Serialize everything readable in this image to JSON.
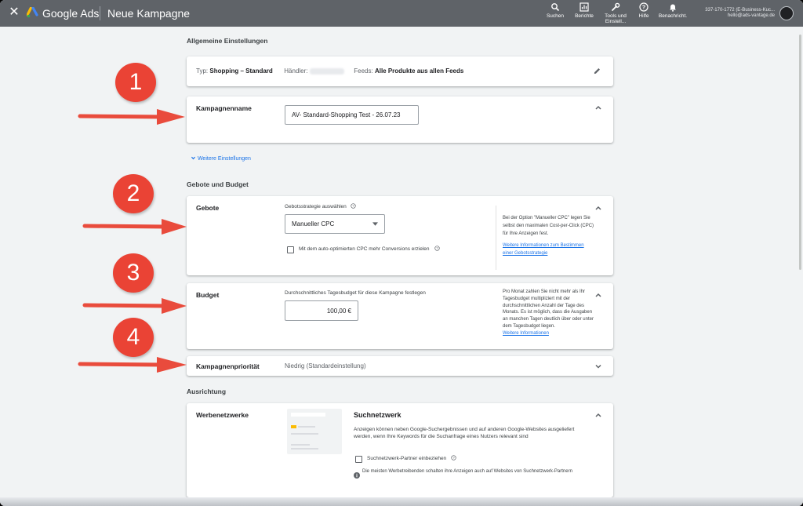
{
  "topbar": {
    "brand": "Google Ads",
    "page_title": "Neue Kampagne",
    "tools": [
      {
        "label": "Suchen",
        "icon": "search-icon"
      },
      {
        "label": "Berichte",
        "icon": "reports-icon"
      },
      {
        "label": "Tools und Einstell...",
        "icon": "wrench-icon"
      },
      {
        "label": "Hilfe",
        "icon": "help-icon"
      },
      {
        "label": "Benachricht.",
        "icon": "bell-icon"
      }
    ],
    "account_id": "337-170-1772 (E-Business-Kuc...",
    "account_email": "hello@ads-vantage.de"
  },
  "general": {
    "heading": "Allgemeine Einstellungen",
    "summary": {
      "type_label": "Typ:",
      "type_value": "Shopping – Standard",
      "merchant_label": "Händler:",
      "feeds_label": "Feeds:",
      "feeds_value": "Alle Produkte aus allen Feeds"
    },
    "campaign_name": {
      "title": "Kampagnenname",
      "value": "AV- Standard-Shopping Test - 26.07.23"
    },
    "more_settings": "Weitere Einstellungen"
  },
  "bids_budget": {
    "heading": "Gebote und Budget",
    "bids": {
      "title": "Gebote",
      "strategy_label": "Gebotsstrategie auswählen",
      "strategy_value": "Manueller CPC",
      "checkbox_label": "Mit dem auto-optimierten CPC mehr Conversions erzielen",
      "help_text": "Bei der Option \"Manueller CPC\" legen Sie selbst den maximalen Cost-per-Click (CPC) für Ihre Anzeigen fest.",
      "help_link": "Weitere Informationen zum Bestimmen einer Gebotsstrategie"
    },
    "budget": {
      "title": "Budget",
      "label": "Durchschnittliches Tagesbudget für diese Kampagne festlegen",
      "value": "100,00 €",
      "help_text": "Pro Monat zahlen Sie nicht mehr als Ihr Tagesbudget multipliziert mit der durchschnittlichen Anzahl der Tage des Monats. Es ist möglich, dass die Ausgaben an manchen Tagen deutlich über oder unter dem Tagesbudget liegen.",
      "help_link": "Weitere Informationen"
    },
    "priority": {
      "title": "Kampagnenpriorität",
      "value": "Niedrig (Standardeinstellung)"
    }
  },
  "targeting": {
    "heading": "Ausrichtung",
    "networks": {
      "title": "Werbenetzwerke",
      "network_title": "Suchnetzwerk",
      "description": "Anzeigen können neben Google-Suchergebnissen und auf anderen Google-Websites ausgeliefert werden, wenn Ihre Keywords für die Suchanfrage eines Nutzers relevant sind",
      "partner_label": "Suchnetzwerk-Partner einbeziehen",
      "info_text": "Die meisten Werbetreibenden schalten ihre Anzeigen auch auf Websites von Suchnetzwerk-Partnern"
    }
  },
  "markers": [
    "1",
    "2",
    "3",
    "4"
  ],
  "colors": {
    "topbar": "#5f6368",
    "page_bg": "#f1f3f4",
    "marker": "#ea4335",
    "link": "#1a73e8",
    "google_blue": "#4285f4",
    "google_yellow": "#fbbc04"
  }
}
